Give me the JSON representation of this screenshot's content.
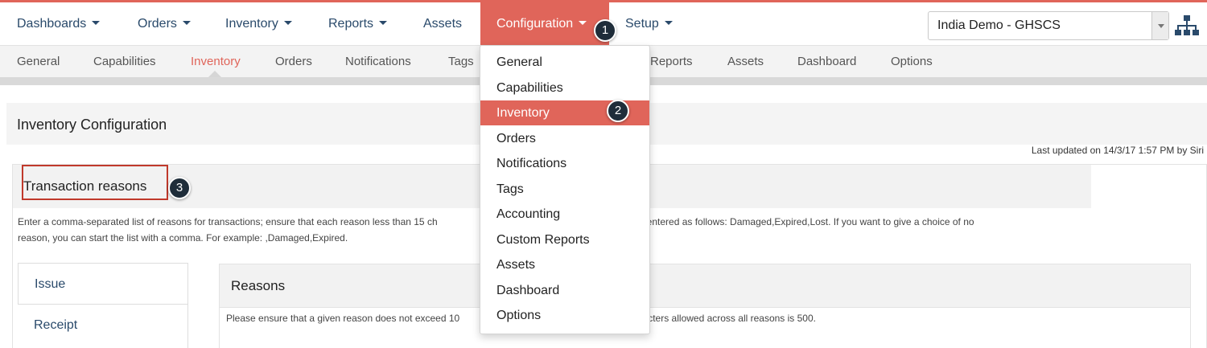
{
  "topnav": {
    "items": [
      {
        "label": "Dashboards"
      },
      {
        "label": "Orders"
      },
      {
        "label": "Inventory"
      },
      {
        "label": "Reports"
      },
      {
        "label": "Assets"
      },
      {
        "label": "Configuration"
      },
      {
        "label": "Setup"
      }
    ],
    "domain_select": "India Demo - GHSCS"
  },
  "subnav": {
    "items": [
      {
        "label": "General"
      },
      {
        "label": "Capabilities"
      },
      {
        "label": "Inventory"
      },
      {
        "label": "Orders"
      },
      {
        "label": "Notifications"
      },
      {
        "label": "Tags"
      },
      {
        "label": "Reports"
      },
      {
        "label": "Assets"
      },
      {
        "label": "Dashboard"
      },
      {
        "label": "Options"
      }
    ]
  },
  "dropdown": {
    "items": [
      {
        "label": "General"
      },
      {
        "label": "Capabilities"
      },
      {
        "label": "Inventory"
      },
      {
        "label": "Orders"
      },
      {
        "label": "Notifications"
      },
      {
        "label": "Tags"
      },
      {
        "label": "Accounting"
      },
      {
        "label": "Custom Reports"
      },
      {
        "label": "Assets"
      },
      {
        "label": "Dashboard"
      },
      {
        "label": "Options"
      }
    ]
  },
  "page": {
    "title": "Inventory Configuration",
    "last_updated": "Last updated on 14/3/17 1:57 PM by Siri"
  },
  "section": {
    "title": "Transaction reasons",
    "desc_line1": "Enter a comma-separated list of reasons for transactions; ensure that each reason less than 15 ch",
    "desc_line1b": "ons can be entered as follows: Damaged,Expired,Lost. If you want to give a choice of no",
    "desc_line2": "reason, you can start the list with a comma. For example: ,Damaged,Expired."
  },
  "tabs": [
    {
      "label": "Issue"
    },
    {
      "label": "Receipt"
    }
  ],
  "reasons": {
    "title": "Reasons",
    "note_a": "Please ensure that a given reason does not exceed 10",
    "note_b": "haracters allowed across all reasons is 500."
  },
  "badges": [
    "1",
    "2",
    "3"
  ],
  "colors": {
    "accent": "#e0655a",
    "link": "#2a4a6b",
    "badge": "#1f2d3a"
  },
  "icons": {
    "domain_select": "chevron-down-icon",
    "hierarchy": "hierarchy-icon"
  }
}
